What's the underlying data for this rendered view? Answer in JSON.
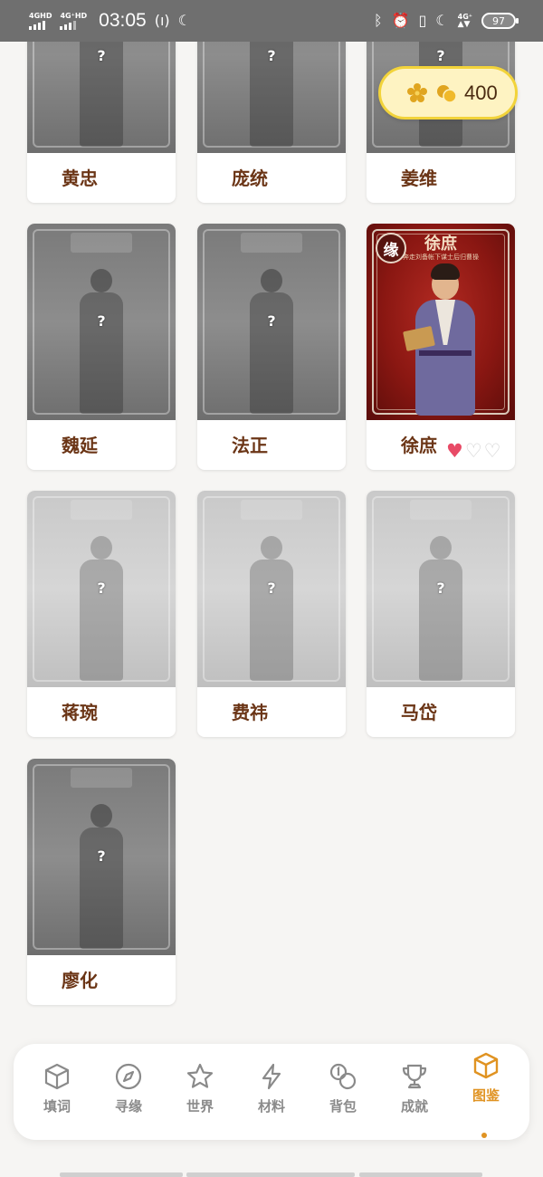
{
  "status_bar": {
    "net1": "4GHD",
    "net2": "4G⁺HD",
    "time": "03:05",
    "net3": "4G⁺",
    "battery": "97"
  },
  "currency": {
    "value": "400",
    "icon": "coin-flower-icon"
  },
  "cards": [
    {
      "name": "黄忠",
      "locked": true,
      "question": "?"
    },
    {
      "name": "庞统",
      "locked": true,
      "question": "?"
    },
    {
      "name": "姜维",
      "locked": true,
      "question": "?"
    },
    {
      "name": "魏延",
      "locked": true,
      "question": "?"
    },
    {
      "name": "法正",
      "locked": true,
      "question": "?"
    },
    {
      "name": "徐庶",
      "locked": false,
      "badge": "缘",
      "title": "徐庶",
      "subtitle": "奔走刘备帐下谋士后归曹操",
      "hearts": {
        "filled": 1,
        "total": 3
      }
    },
    {
      "name": "蒋琬",
      "locked": true,
      "question": "?"
    },
    {
      "name": "费祎",
      "locked": true,
      "question": "?"
    },
    {
      "name": "马岱",
      "locked": true,
      "question": "?"
    },
    {
      "name": "廖化",
      "locked": true,
      "question": "?"
    }
  ],
  "nav": [
    {
      "label": "填词",
      "icon": "cube-icon",
      "active": false
    },
    {
      "label": "寻缘",
      "icon": "compass-icon",
      "active": false
    },
    {
      "label": "世界",
      "icon": "star-icon",
      "active": false
    },
    {
      "label": "材料",
      "icon": "lightning-icon",
      "active": false
    },
    {
      "label": "背包",
      "icon": "coins-icon",
      "active": false
    },
    {
      "label": "成就",
      "icon": "trophy-icon",
      "active": false
    },
    {
      "label": "图鉴",
      "icon": "cube-icon",
      "active": true
    }
  ],
  "colors": {
    "accent": "#e09322",
    "name_text": "#6b3516",
    "heart": "#e84a66",
    "currency_border": "#f2d33a"
  }
}
